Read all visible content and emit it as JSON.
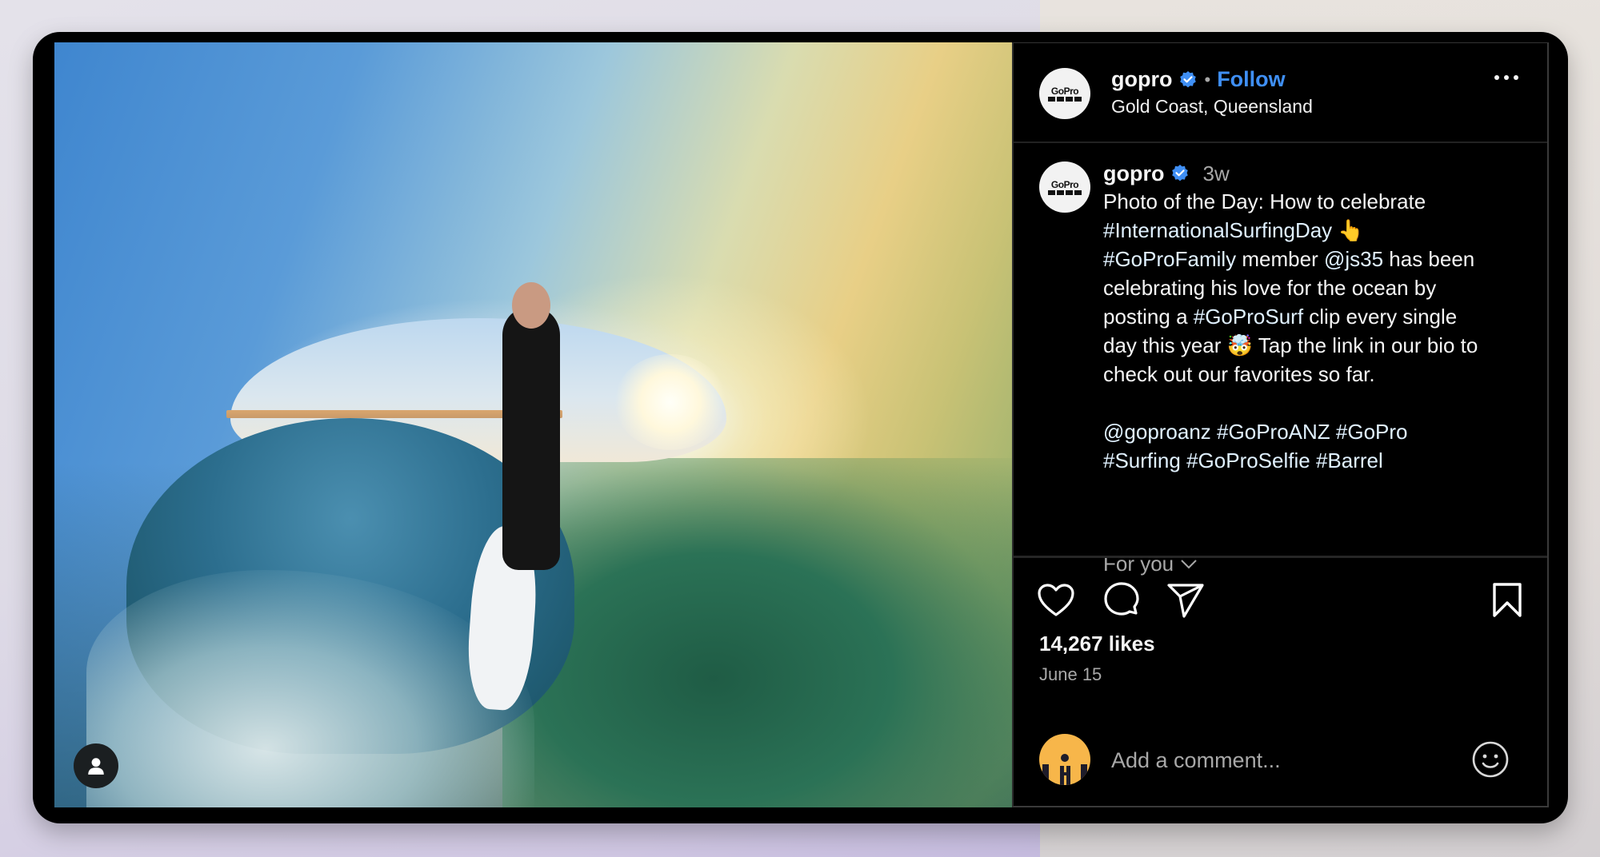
{
  "post": {
    "author": "gopro",
    "verified": true,
    "separator": "•",
    "follow_label": "Follow",
    "location": "Gold Coast, Queensland",
    "logo_text": "GoPro",
    "more_label": "More options"
  },
  "caption": {
    "author": "gopro",
    "time_ago": "3w",
    "lines": [
      [
        {
          "t": "Photo of the Day: How to celebrate"
        }
      ],
      [
        {
          "t": "#InternationalSurfingDay",
          "tag": true
        },
        {
          "t": " 👆"
        }
      ],
      [
        {
          "t": "#GoProFamily",
          "tag": true
        },
        {
          "t": " member "
        },
        {
          "t": "@js35",
          "tag": true
        },
        {
          "t": " has been"
        }
      ],
      [
        {
          "t": "celebrating his love for the ocean by"
        }
      ],
      [
        {
          "t": "posting a "
        },
        {
          "t": "#GoProSurf",
          "tag": true
        },
        {
          "t": " clip every single"
        }
      ],
      [
        {
          "t": "day this year 🤯 Tap the link in our bio to"
        }
      ],
      [
        {
          "t": "check out our favorites so far."
        }
      ],
      [
        {
          "t": ""
        }
      ],
      [
        {
          "t": "@goproanz",
          "tag": true
        },
        {
          "t": " "
        },
        {
          "t": "#GoProANZ",
          "tag": true
        },
        {
          "t": " "
        },
        {
          "t": "#GoPro",
          "tag": true
        }
      ],
      [
        {
          "t": "#Surfing",
          "tag": true
        },
        {
          "t": " "
        },
        {
          "t": "#GoProSelfie",
          "tag": true
        },
        {
          "t": " "
        },
        {
          "t": "#Barrel",
          "tag": true
        }
      ]
    ],
    "for_you_label": "For you"
  },
  "actions": {
    "like_icon": "heart-icon",
    "comment_icon": "comment-icon",
    "share_icon": "paper-plane-icon",
    "save_icon": "bookmark-icon"
  },
  "stats": {
    "likes": "14,267 likes",
    "date": "June 15"
  },
  "comment": {
    "placeholder": "Add a comment...",
    "emoji_icon": "smiley-icon"
  },
  "media": {
    "description": "Surfer taking a selfie inside a barrel wave at sunrise",
    "tagged_users_icon": "user-icon"
  },
  "colors": {
    "accent": "#3f8ff5",
    "verified": "#3f8ff5",
    "panel_bg": "#000000",
    "secondary_text": "#a8a8a8",
    "avatar_bg": "#f7b64a"
  }
}
